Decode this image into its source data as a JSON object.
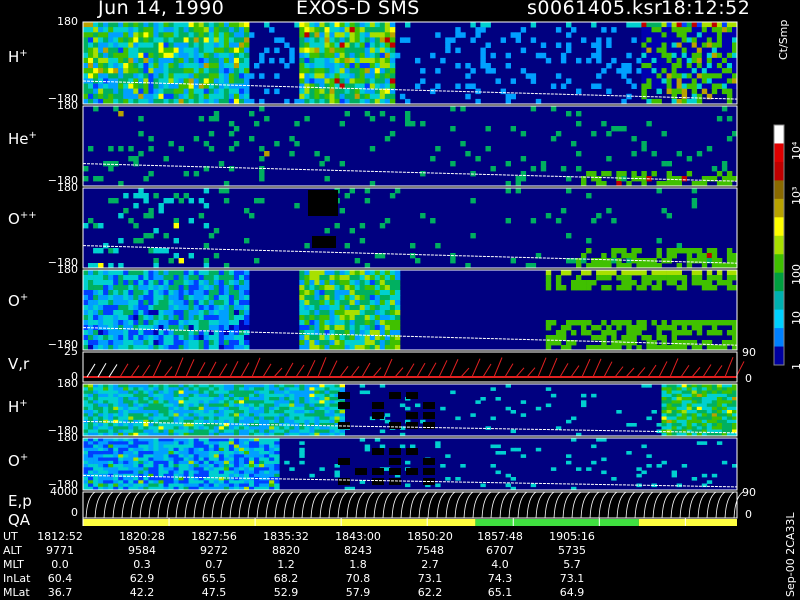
{
  "header": {
    "date": "Jun 14, 1990",
    "instrument": "EXOS-D SMS",
    "file": "s0061405.ksr",
    "time": "18:12:52"
  },
  "panels": [
    {
      "id": "h-plus",
      "label_base": "H",
      "label_sup": "+",
      "top_tick": "180",
      "bottom_tick": "−180"
    },
    {
      "id": "he-plus",
      "label_base": "He",
      "label_sup": "+",
      "top_tick": "180",
      "bottom_tick": "−180"
    },
    {
      "id": "o-plus-plus",
      "label_base": "O",
      "label_sup": "++",
      "top_tick": "180",
      "bottom_tick": "−180"
    },
    {
      "id": "o-plus",
      "label_base": "O",
      "label_sup": "+",
      "top_tick": "180",
      "bottom_tick": "−180"
    },
    {
      "id": "vr",
      "label_base": "V,r",
      "label_sup": "",
      "top_tick": "25",
      "bottom_tick": "0",
      "right_top": "90",
      "right_bottom": "0"
    },
    {
      "id": "h-plus-2",
      "label_base": "H",
      "label_sup": "+",
      "top_tick": "180",
      "bottom_tick": "−180"
    },
    {
      "id": "o-plus-2",
      "label_base": "O",
      "label_sup": "+",
      "top_tick": "180",
      "bottom_tick": "−180"
    },
    {
      "id": "ep",
      "label_base": "E,p",
      "label_sup": "",
      "top_tick": "4000",
      "bottom_tick": "0",
      "right_top": "90",
      "right_bottom": "0"
    },
    {
      "id": "qa",
      "label_base": "QA",
      "label_sup": "",
      "top_tick": "",
      "bottom_tick": ""
    }
  ],
  "colorbar": {
    "title": "Ct/Smp",
    "ticks": [
      "10⁴",
      "10³",
      "100",
      "10",
      "1"
    ],
    "colors": [
      "#ffffff",
      "#e00000",
      "#c00000",
      "#8a6a00",
      "#b8a200",
      "#ffff00",
      "#a8e000",
      "#40c000",
      "#00a040",
      "#00b0b0",
      "#00d0ff",
      "#0080ff",
      "#0000a0"
    ]
  },
  "orbit": {
    "rows": [
      {
        "label": "UT",
        "values": [
          "1812:52",
          "1820:28",
          "1827:56",
          "1835:32",
          "1843:00",
          "1850:20",
          "1857:48",
          "1905:16"
        ]
      },
      {
        "label": "ALT",
        "values": [
          "9771",
          "9584",
          "9272",
          "8820",
          "8243",
          "7548",
          "6707",
          "5735"
        ]
      },
      {
        "label": "MLT",
        "values": [
          "0.0",
          "0.3",
          "0.7",
          "1.2",
          "1.8",
          "2.7",
          "4.0",
          "5.7"
        ]
      },
      {
        "label": "InLat",
        "values": [
          "60.4",
          "62.9",
          "65.5",
          "68.2",
          "70.8",
          "73.1",
          "74.3",
          "73.1"
        ]
      },
      {
        "label": "MLat",
        "values": [
          "36.7",
          "42.2",
          "47.5",
          "52.9",
          "57.9",
          "62.2",
          "65.1",
          "64.9"
        ]
      }
    ]
  },
  "version": "Sep-00 2CA33L",
  "chart_data": {
    "type": "heatmap",
    "x_labels": [
      "1812:52",
      "1820:28",
      "1827:56",
      "1835:32",
      "1843:00",
      "1850:20",
      "1857:48",
      "1905:16"
    ],
    "panels": [
      "H+",
      "He+",
      "O++",
      "O+",
      "V,r",
      "H+",
      "O+",
      "E,p",
      "QA"
    ],
    "ylim_angle": [
      -180,
      180
    ],
    "ylim_vr": [
      0,
      25
    ],
    "ylim_ep": [
      0,
      4000
    ],
    "colorbar_range": [
      1,
      10000
    ],
    "colorbar_scale": "log",
    "qa_segments": [
      {
        "start": 0.0,
        "end": 0.6,
        "color": "#ffff40"
      },
      {
        "start": 0.6,
        "end": 0.85,
        "color": "#40e040"
      },
      {
        "start": 0.85,
        "end": 1.0,
        "color": "#ffff40"
      }
    ]
  }
}
